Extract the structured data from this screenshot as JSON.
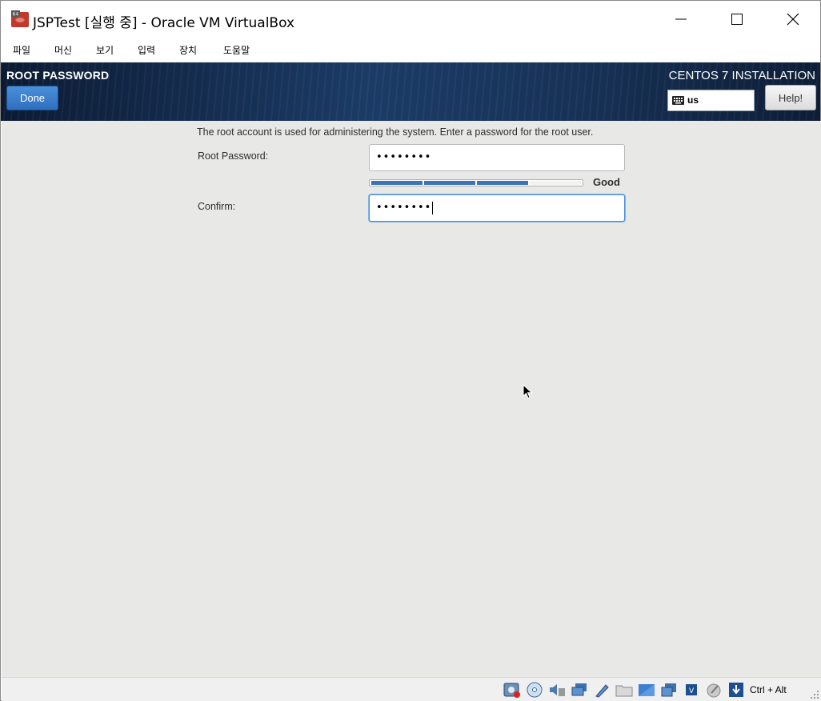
{
  "window": {
    "title": "JSPTest [실행 중] - Oracle VM VirtualBox"
  },
  "menu": {
    "items": [
      "파일",
      "머신",
      "보기",
      "입력",
      "장치",
      "도움말"
    ]
  },
  "header": {
    "spoke_title": "ROOT PASSWORD",
    "done_label": "Done",
    "installation_title": "CENTOS 7 INSTALLATION",
    "keyboard_layout": "us",
    "help_label": "Help!"
  },
  "form": {
    "description": "The root account is used for administering the system.  Enter a password for the root user.",
    "root_password_label": "Root Password:",
    "root_password_value": "••••••••",
    "strength_label": "Good",
    "strength_fraction": 0.75,
    "confirm_label": "Confirm:",
    "confirm_value": "••••••••"
  },
  "statusbar": {
    "host_key": "Ctrl + Alt",
    "icons": [
      "optical-drive-icon",
      "cd-icon",
      "audio-icon",
      "network-icon",
      "usb-icon",
      "shared-folder-icon",
      "display-icon",
      "screen-capture-icon",
      "cpu-icon",
      "mouse-integration-icon",
      "download-arrow-icon"
    ]
  },
  "colors": {
    "accent": "#3a73b8",
    "header_dark": "#0c1b33",
    "content_bg": "#e8e8e7"
  }
}
